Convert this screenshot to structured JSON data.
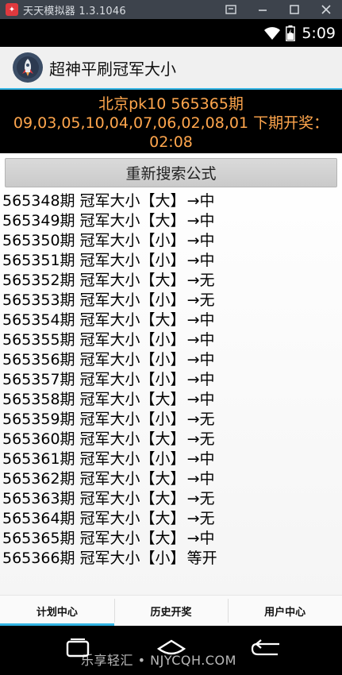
{
  "emulator": {
    "title": "天天模拟器 1.3.1046",
    "logo_icon": "tiantian-logo-icon"
  },
  "status_bar": {
    "time": "5:09",
    "icons": [
      "wifi-icon",
      "battery-charging-icon"
    ]
  },
  "header": {
    "app_icon": "rocket-icon",
    "title": "超神平刷冠军大小"
  },
  "banner": {
    "line1": "北京pk10 565365期",
    "line2": "09,03,05,10,04,07,06,02,08,01 下期开奖：",
    "line3": "02:08"
  },
  "refresh_button": "重新搜索公式",
  "rows": [
    {
      "period": "565348期",
      "label": "冠军大小",
      "pick": "【大】",
      "result": "→中"
    },
    {
      "period": "565349期",
      "label": "冠军大小",
      "pick": "【大】",
      "result": "→中"
    },
    {
      "period": "565350期",
      "label": "冠军大小",
      "pick": "【小】",
      "result": "→中"
    },
    {
      "period": "565351期",
      "label": "冠军大小",
      "pick": "【小】",
      "result": "→中"
    },
    {
      "period": "565352期",
      "label": "冠军大小",
      "pick": "【大】",
      "result": "→无"
    },
    {
      "period": "565353期",
      "label": "冠军大小",
      "pick": "【小】",
      "result": "→无"
    },
    {
      "period": "565354期",
      "label": "冠军大小",
      "pick": "【大】",
      "result": "→中"
    },
    {
      "period": "565355期",
      "label": "冠军大小",
      "pick": "【小】",
      "result": "→中"
    },
    {
      "period": "565356期",
      "label": "冠军大小",
      "pick": "【小】",
      "result": "→中"
    },
    {
      "period": "565357期",
      "label": "冠军大小",
      "pick": "【小】",
      "result": "→中"
    },
    {
      "period": "565358期",
      "label": "冠军大小",
      "pick": "【大】",
      "result": "→中"
    },
    {
      "period": "565359期",
      "label": "冠军大小",
      "pick": "【小】",
      "result": "→无"
    },
    {
      "period": "565360期",
      "label": "冠军大小",
      "pick": "【大】",
      "result": "→无"
    },
    {
      "period": "565361期",
      "label": "冠军大小",
      "pick": "【小】",
      "result": "→中"
    },
    {
      "period": "565362期",
      "label": "冠军大小",
      "pick": "【大】",
      "result": "→中"
    },
    {
      "period": "565363期",
      "label": "冠军大小",
      "pick": "【大】",
      "result": "→无"
    },
    {
      "period": "565364期",
      "label": "冠军大小",
      "pick": "【大】",
      "result": "→无"
    },
    {
      "period": "565365期",
      "label": "冠军大小",
      "pick": "【大】",
      "result": "→中"
    },
    {
      "period": "565366期",
      "label": "冠军大小",
      "pick": "【小】",
      "result": "等开"
    }
  ],
  "tabs": [
    {
      "label": "计划中心",
      "active": true
    },
    {
      "label": "历史开奖",
      "active": false
    },
    {
      "label": "用户中心",
      "active": false
    }
  ],
  "nav_bar": {
    "icons": [
      "recent-apps-icon",
      "home-icon",
      "back-icon"
    ]
  },
  "watermark": "乐享轻汇 • NJYCQH.COM",
  "colors": {
    "accent": "#33b5e5",
    "banner_text": "#ffa64d",
    "emulator_bar": "#3d434c"
  }
}
